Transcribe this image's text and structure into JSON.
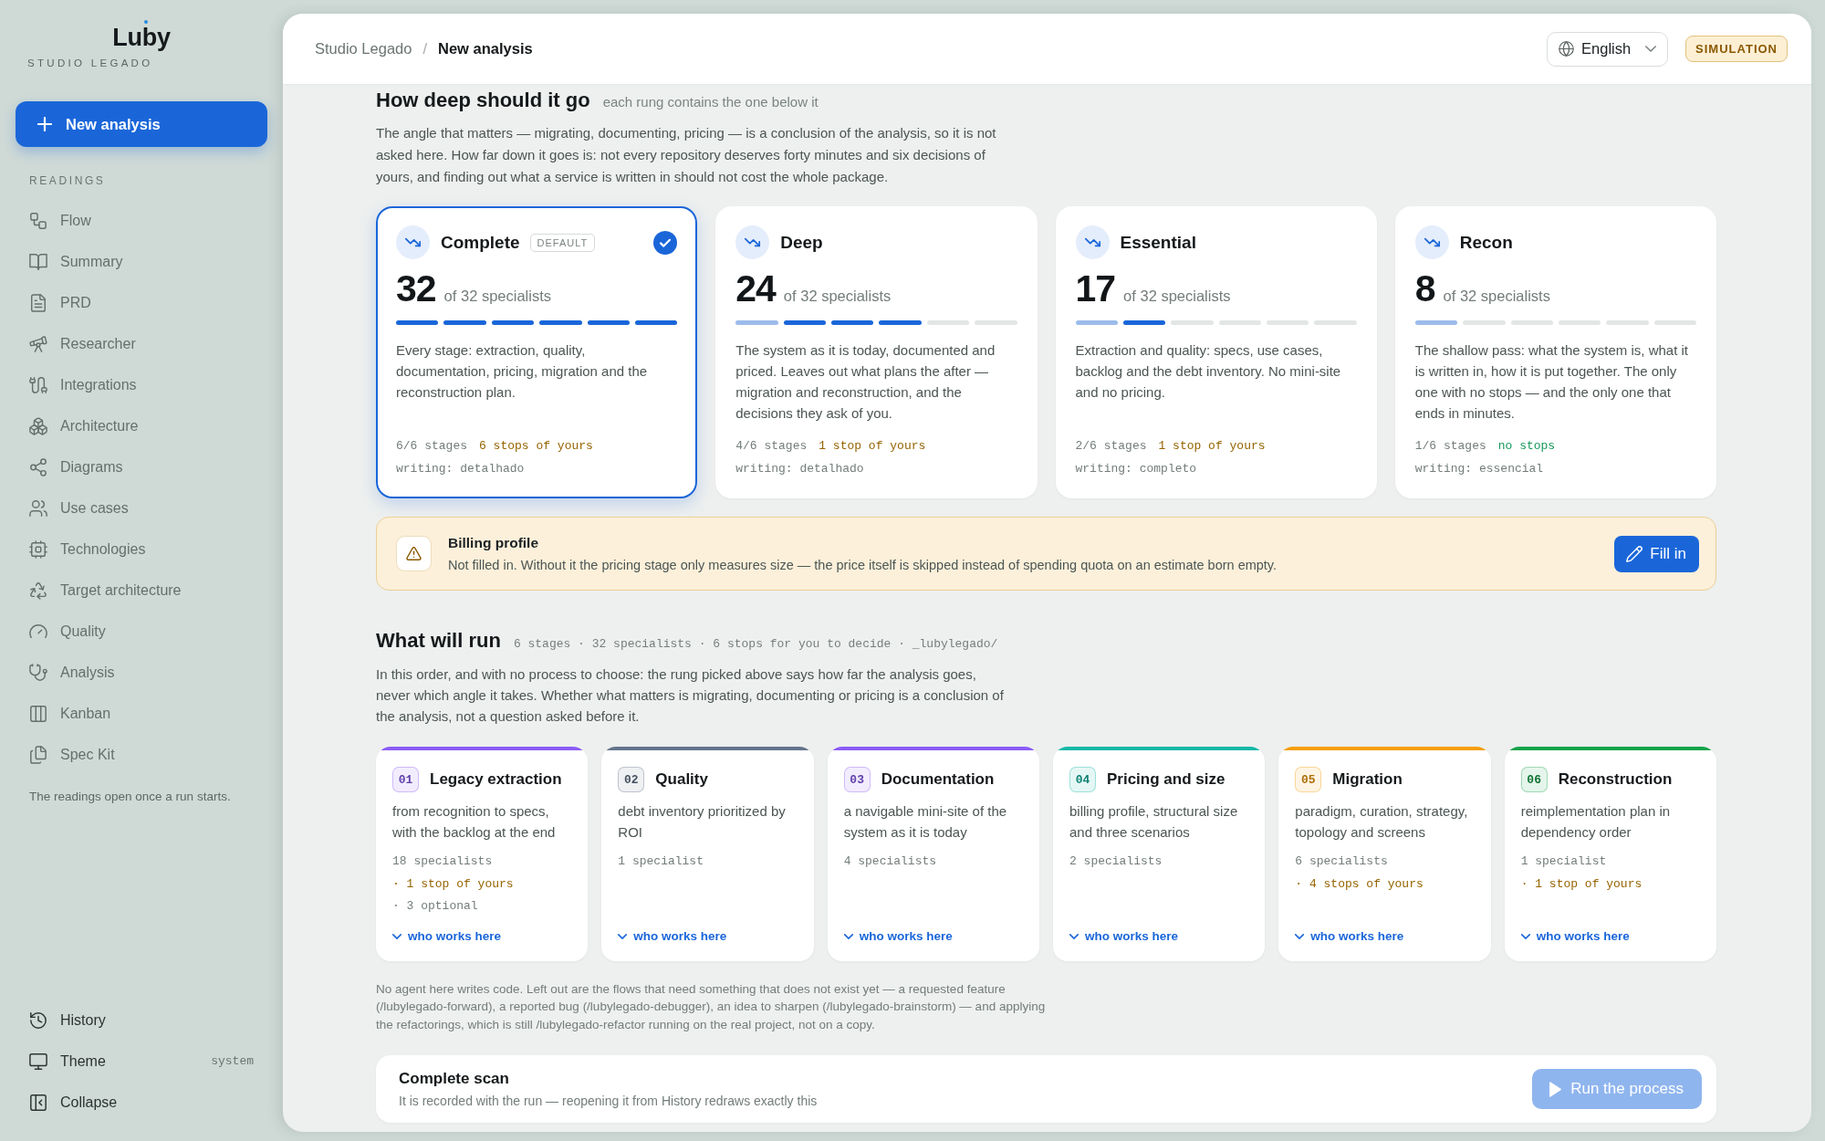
{
  "sidebar": {
    "logo": "Luby",
    "subtitle": "STUDIO LEGADO",
    "new_button": "New analysis",
    "section_label": "READINGS",
    "items": [
      {
        "label": "Flow",
        "disabled": true
      },
      {
        "label": "Summary",
        "disabled": true
      },
      {
        "label": "PRD",
        "disabled": true
      },
      {
        "label": "Researcher",
        "disabled": true
      },
      {
        "label": "Integrations",
        "disabled": true
      },
      {
        "label": "Architecture",
        "disabled": true
      },
      {
        "label": "Diagrams",
        "disabled": true
      },
      {
        "label": "Use cases",
        "disabled": true
      },
      {
        "label": "Technologies",
        "disabled": true
      },
      {
        "label": "Target architecture",
        "disabled": true
      },
      {
        "label": "Quality",
        "disabled": true
      },
      {
        "label": "Analysis",
        "disabled": true
      },
      {
        "label": "Kanban",
        "disabled": true
      },
      {
        "label": "Spec Kit",
        "disabled": true
      }
    ],
    "note": "The readings open once a run starts.",
    "footer_items": [
      {
        "label": "History"
      },
      {
        "label": "Theme",
        "value": "system"
      },
      {
        "label": "Collapse"
      }
    ]
  },
  "header": {
    "breadcrumb": [
      "Studio Legado",
      "New analysis"
    ],
    "separator": "/",
    "language": "English",
    "badge": "SIMULATION"
  },
  "depth": {
    "title": "How deep should it go",
    "subtitle": "each rung contains the one below it",
    "intro": "The angle that matters — migrating, documenting, pricing — is a conclusion of the analysis, so it is not asked here. How far down it goes is: not every repository deserves forty minutes and six decisions of yours, and finding out what a service is written in should not cost the whole package.",
    "options": [
      {
        "name": "Complete",
        "badge": "DEFAULT",
        "selected": true,
        "count": "32",
        "total": "of 32 specialists",
        "segments": [
          {
            "kind": "full"
          },
          {
            "kind": "full"
          },
          {
            "kind": "full"
          },
          {
            "kind": "full"
          },
          {
            "kind": "full"
          },
          {
            "kind": "full"
          }
        ],
        "description": "Every stage: extraction, quality, documentation, pricing, migration and the reconstruction plan.",
        "stages": "6/6 stages",
        "stops": "6 stops of yours",
        "has_stops": true,
        "writing": "writing: detalhado"
      },
      {
        "name": "Deep",
        "selected": false,
        "count": "24",
        "total": "of 32 specialists",
        "segments": [
          {
            "kind": "partial"
          },
          {
            "kind": "full"
          },
          {
            "kind": "full"
          },
          {
            "kind": "full"
          },
          {
            "kind": "empty"
          },
          {
            "kind": "empty"
          }
        ],
        "description": "The system as it is today, documented and priced. Leaves out what plans the after — migration and reconstruction, and the decisions they ask of you.",
        "stages": "4/6 stages",
        "stops": "1 stop of yours",
        "has_stops": true,
        "writing": "writing: detalhado"
      },
      {
        "name": "Essential",
        "selected": false,
        "count": "17",
        "total": "of 32 specialists",
        "segments": [
          {
            "kind": "partial"
          },
          {
            "kind": "full"
          },
          {
            "kind": "empty"
          },
          {
            "kind": "empty"
          },
          {
            "kind": "empty"
          },
          {
            "kind": "empty"
          }
        ],
        "description": "Extraction and quality: specs, use cases, backlog and the debt inventory. No mini-site and no pricing.",
        "stages": "2/6 stages",
        "stops": "1 stop of yours",
        "has_stops": true,
        "writing": "writing: completo"
      },
      {
        "name": "Recon",
        "selected": false,
        "count": "8",
        "total": "of 32 specialists",
        "segments": [
          {
            "kind": "partial"
          },
          {
            "kind": "empty"
          },
          {
            "kind": "empty"
          },
          {
            "kind": "empty"
          },
          {
            "kind": "empty"
          },
          {
            "kind": "empty"
          }
        ],
        "description": "The shallow pass: what the system is, what it is written in, how it is put together. The only one with no stops — and the only one that ends in minutes.",
        "stages": "1/6 stages",
        "stops": "no stops",
        "has_stops": false,
        "writing": "writing: essencial"
      }
    ]
  },
  "billing": {
    "title": "Billing profile",
    "text": "Not filled in. Without it the pricing stage only measures size — the price itself is skipped instead of spending quota on an estimate born empty.",
    "button": "Fill in"
  },
  "run": {
    "title": "What will run",
    "meta": "6 stages · 32 specialists · 6 stops for you to decide · _lubylegado/",
    "intro": "In this order, and with no process to choose: the rung picked above says how far the analysis goes, never which angle it takes. Whether what matters is migrating, documenting or pricing is a conclusion of the analysis, not a question asked before it.",
    "stages": [
      {
        "number": "01",
        "name": "Legacy extraction",
        "color": "#8b5cf6",
        "description": "from recognition to specs, with the backlog at the end",
        "details": [
          {
            "text": "18 specialists",
            "kind": "count"
          },
          {
            "text": "· 1 stop of yours",
            "kind": "stop"
          },
          {
            "text": "· 3 optional",
            "kind": "count"
          }
        ],
        "link": "who works here"
      },
      {
        "number": "02",
        "name": "Quality",
        "color": "#64748b",
        "description": "debt inventory prioritized by ROI",
        "details": [
          {
            "text": "1 specialist",
            "kind": "count"
          }
        ],
        "link": "who works here"
      },
      {
        "number": "03",
        "name": "Documentation",
        "color": "#8b5cf6",
        "description": "a navigable mini-site of the system as it is today",
        "details": [
          {
            "text": "4 specialists",
            "kind": "count"
          }
        ],
        "link": "who works here"
      },
      {
        "number": "04",
        "name": "Pricing and size",
        "color": "#14b8a6",
        "description": "billing profile, structural size and three scenarios",
        "details": [
          {
            "text": "2 specialists",
            "kind": "count"
          }
        ],
        "link": "who works here"
      },
      {
        "number": "05",
        "name": "Migration",
        "color": "#f59e0b",
        "description": "paradigm, curation, strategy, topology and screens",
        "details": [
          {
            "text": "6 specialists",
            "kind": "count"
          },
          {
            "text": "· 4 stops of yours",
            "kind": "stop"
          }
        ],
        "link": "who works here"
      },
      {
        "number": "06",
        "name": "Reconstruction",
        "color": "#16a34a",
        "description": "reimplementation plan in dependency order",
        "details": [
          {
            "text": "1 specialist",
            "kind": "count"
          },
          {
            "text": "· 1 stop of yours",
            "kind": "stop"
          }
        ],
        "link": "who works here"
      }
    ],
    "footnote": "No agent here writes code. Left out are the flows that need something that does not exist yet — a requested feature (/lubylegado-forward), a reported bug (/lubylegado-debugger), an idea to sharpen (/lubylegado-brainstorm) — and applying the refactorings, which is still /lubylegado-refactor running on the real project, not on a copy."
  },
  "final": {
    "title": "Complete scan",
    "text": "It is recorded with the run — reopening it from History redraws exactly this",
    "button": "Run the process",
    "disabled": true
  }
}
